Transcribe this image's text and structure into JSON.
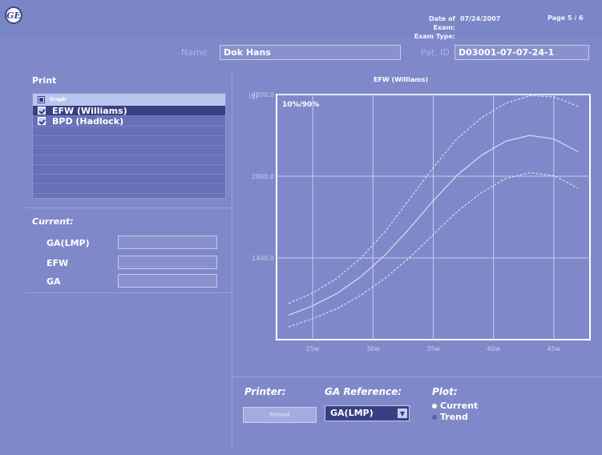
{
  "header": {
    "exam_date_label": "Date of Exam:",
    "exam_date_value": "07/24/2007",
    "exam_type_label": "Exam Type:",
    "exam_type_value": "",
    "page_info": "Page 5 / 6"
  },
  "patient": {
    "name_label": "Name",
    "name_value": "Dok Hans",
    "pid_label": "Pat. ID",
    "pid_value": "D03001-07-07-24-1"
  },
  "print_panel": {
    "title": "Print",
    "header_label": "Graph",
    "items": [
      {
        "label": "EFW (Williams)",
        "checked": true,
        "selected": true
      },
      {
        "label": "BPD (Hadlock)",
        "checked": true,
        "selected": false
      }
    ]
  },
  "current_panel": {
    "title": "Current:",
    "fields": [
      {
        "label": "GA(LMP)",
        "value": ""
      },
      {
        "label": "EFW",
        "value": ""
      },
      {
        "label": "GA",
        "value": ""
      }
    ]
  },
  "chart_data": {
    "type": "line",
    "title": "EFW (Williams)",
    "ylabel": "[g]",
    "annotation": "10%/90%",
    "x_ticks": [
      {
        "x": 25,
        "label": "25w"
      },
      {
        "x": 30,
        "label": "30w"
      },
      {
        "x": 35,
        "label": "35w"
      },
      {
        "x": 40,
        "label": "40w"
      },
      {
        "x": 45,
        "label": "45w"
      }
    ],
    "y_ticks": [
      {
        "y": 1400,
        "label": "1400.0"
      },
      {
        "y": 2800,
        "label": "2800.0"
      },
      {
        "y": 4200,
        "label": "4200.0"
      }
    ],
    "xlim": [
      22,
      48
    ],
    "ylim": [
      0,
      4200
    ],
    "grid": true,
    "series": [
      {
        "values_x": [
          23,
          25,
          27,
          29,
          31,
          33,
          35,
          37,
          39,
          41,
          43,
          45,
          47
        ],
        "values_y": [
          620,
          800,
          1050,
          1400,
          1850,
          2400,
          2950,
          3450,
          3800,
          4050,
          4180,
          4160,
          4000
        ],
        "style": "dashed"
      },
      {
        "values_x": [
          23,
          25,
          27,
          29,
          31,
          33,
          35,
          37,
          39,
          41,
          43,
          45,
          47
        ],
        "values_y": [
          420,
          580,
          790,
          1080,
          1450,
          1900,
          2380,
          2820,
          3160,
          3400,
          3500,
          3440,
          3220
        ],
        "style": "solid"
      },
      {
        "values_x": [
          23,
          25,
          27,
          29,
          31,
          33,
          35,
          37,
          39,
          41,
          43,
          45,
          47
        ],
        "values_y": [
          220,
          360,
          530,
          760,
          1050,
          1400,
          1800,
          2200,
          2520,
          2760,
          2860,
          2810,
          2600
        ],
        "style": "dashed"
      }
    ]
  },
  "bottom": {
    "printer_label": "Printer:",
    "format_button": "Format",
    "garef_label": "GA Reference:",
    "garef_value": "GA(LMP)",
    "plot_label": "Plot:",
    "plot_options": [
      {
        "label": "Current",
        "selected": true
      },
      {
        "label": "Trend",
        "selected": false
      }
    ]
  },
  "colors": {
    "background": "#7f89c9",
    "selected_row": "#3a3f82",
    "curve": "#d8dcf5"
  }
}
